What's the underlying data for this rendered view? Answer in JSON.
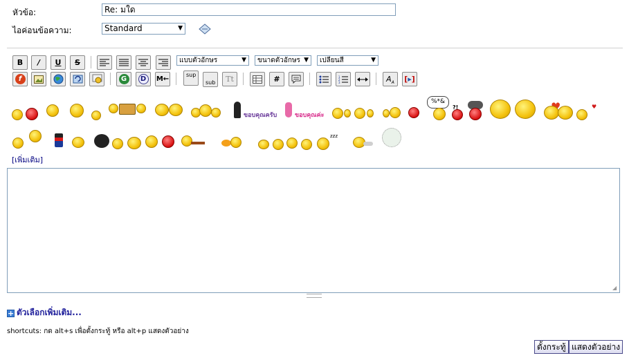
{
  "form": {
    "subject_label": "หัวข้อ:",
    "subject_value": "Re: มใด",
    "icon_label": "ไอค่อนข้อความ:",
    "icon_select": "Standard"
  },
  "toolbar": {
    "bold": "B",
    "italic": "/",
    "underline": "U",
    "strike": "S",
    "font_select": "แบบตัวอักษร",
    "size_select": "ขนาดตัวอักษร",
    "color_select": "เปลี่ยนสี",
    "flash": "f",
    "google": "G",
    "dict": "D",
    "sup": "sup",
    "sub": "sub",
    "tt": "Tt",
    "hash": "#"
  },
  "smileys": {
    "thanks_m": "ขอบคุณครับ",
    "thanks_f": "ขอบคุณค่ะ",
    "swear": "%*&",
    "qmark": "?!",
    "zzz": "zzz"
  },
  "editor": {
    "more_link": "[เพิ่มเติม]",
    "more_options": "ตัวเลือกเพิ่มเติม...",
    "shortcuts": "shortcuts: กด alt+s เพื่อตั้งกระทู้ หรือ alt+p แสดงตัวอย่าง"
  },
  "buttons": {
    "submit": "ตั้งกระทู้",
    "preview": "แสดงตัวอย่าง"
  }
}
